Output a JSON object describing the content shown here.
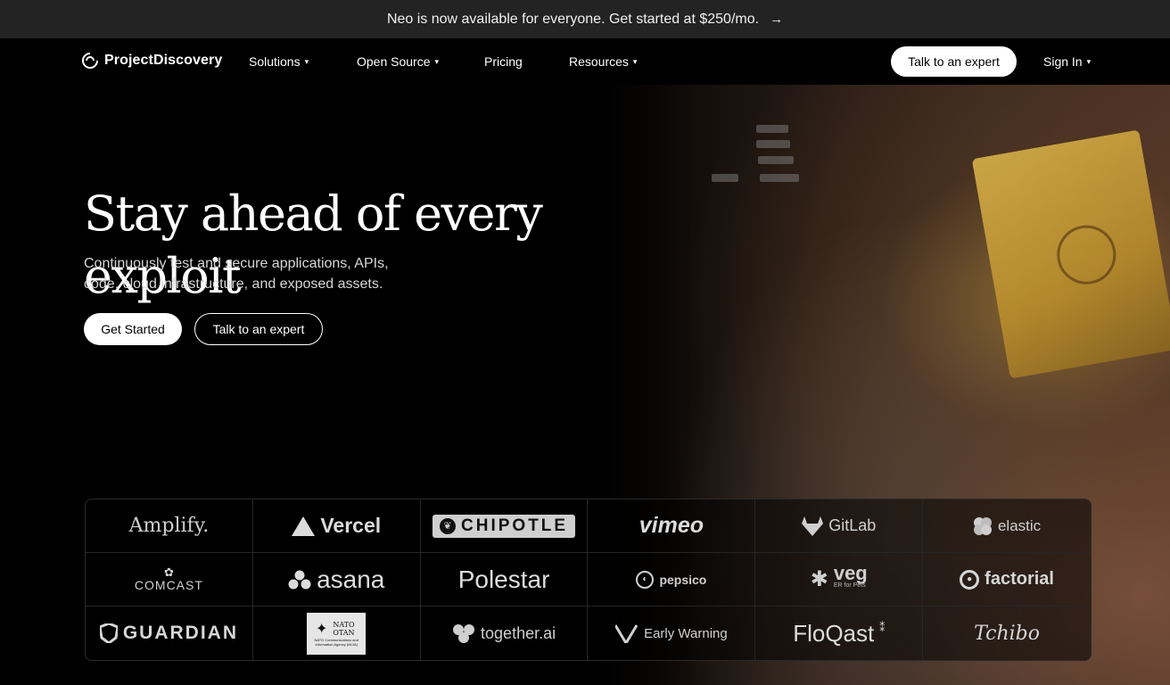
{
  "announcement": {
    "text": "Neo is now available for everyone. Get started at $250/mo.",
    "arrow": "→"
  },
  "nav": {
    "logo_text": "ProjectDiscovery",
    "items": [
      {
        "label": "Solutions",
        "has_caret": true
      },
      {
        "label": "Open Source",
        "has_caret": true
      },
      {
        "label": "Pricing",
        "has_caret": false
      },
      {
        "label": "Resources",
        "has_caret": true
      }
    ],
    "cta": "Talk to an expert",
    "sign_in": "Sign In",
    "caret": "▾"
  },
  "hero": {
    "title": "Stay ahead of every exploit",
    "subtitle": "Continuously test and secure applications, APIs, code, cloud infrastructure, and exposed assets.",
    "primary_button": "Get Started",
    "secondary_button": "Talk to an expert"
  },
  "customers": {
    "logos": [
      "Amplify.",
      "Vercel",
      "CHIPOTLE",
      "vimeo",
      "GitLab",
      "elastic",
      "COMCAST",
      "asana",
      "Polestar",
      "pepsico",
      "veg",
      "factorial",
      "GUARDIAN",
      "NATO OTAN",
      "together.ai",
      "Early Warning",
      "FloQast",
      "Tchibo"
    ],
    "nato_caption": "NATO Communications and Information Agency (NCIA)",
    "veg_caption": "ER for Pets"
  },
  "colors": {
    "accent": "#ffffff",
    "background": "#000000",
    "announce_bg": "#232323"
  }
}
